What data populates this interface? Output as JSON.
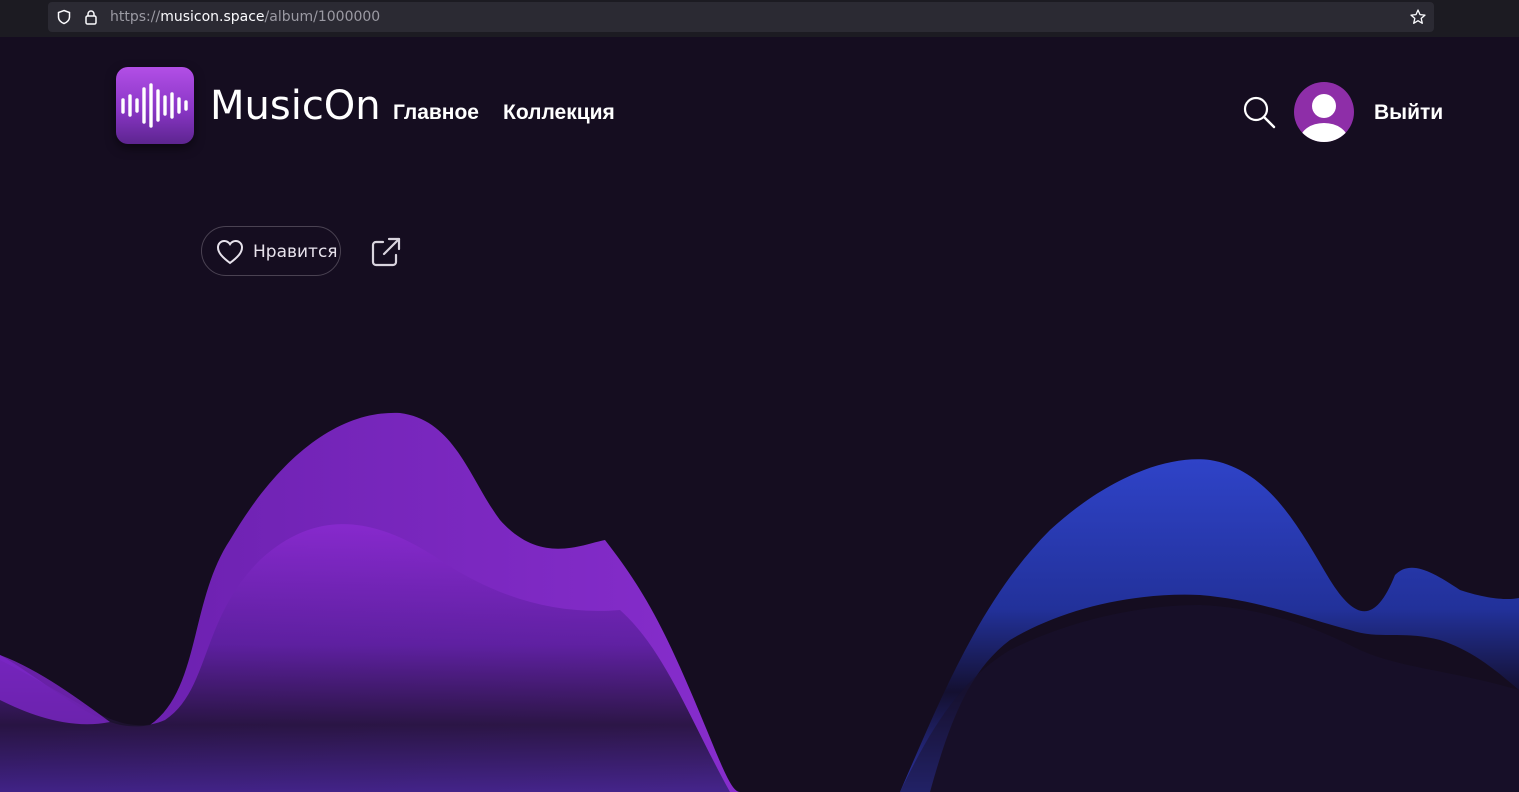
{
  "browser": {
    "url_scheme": "https://",
    "url_host": "musicon.space",
    "url_path": "/album/1000000"
  },
  "header": {
    "brand": "MusicOn",
    "nav": [
      {
        "label": "Главное"
      },
      {
        "label": "Коллекция"
      }
    ],
    "logout_label": "Выйти",
    "logo_colors": {
      "top": "#b24fe6",
      "bottom": "#5d2590"
    },
    "avatar_color": "#8e2ea8"
  },
  "actions": {
    "like_label": "Нравится"
  },
  "colors": {
    "background": "#150d20",
    "wave_purple": "#7a22c4",
    "wave_blue": "#2d3bb0"
  }
}
